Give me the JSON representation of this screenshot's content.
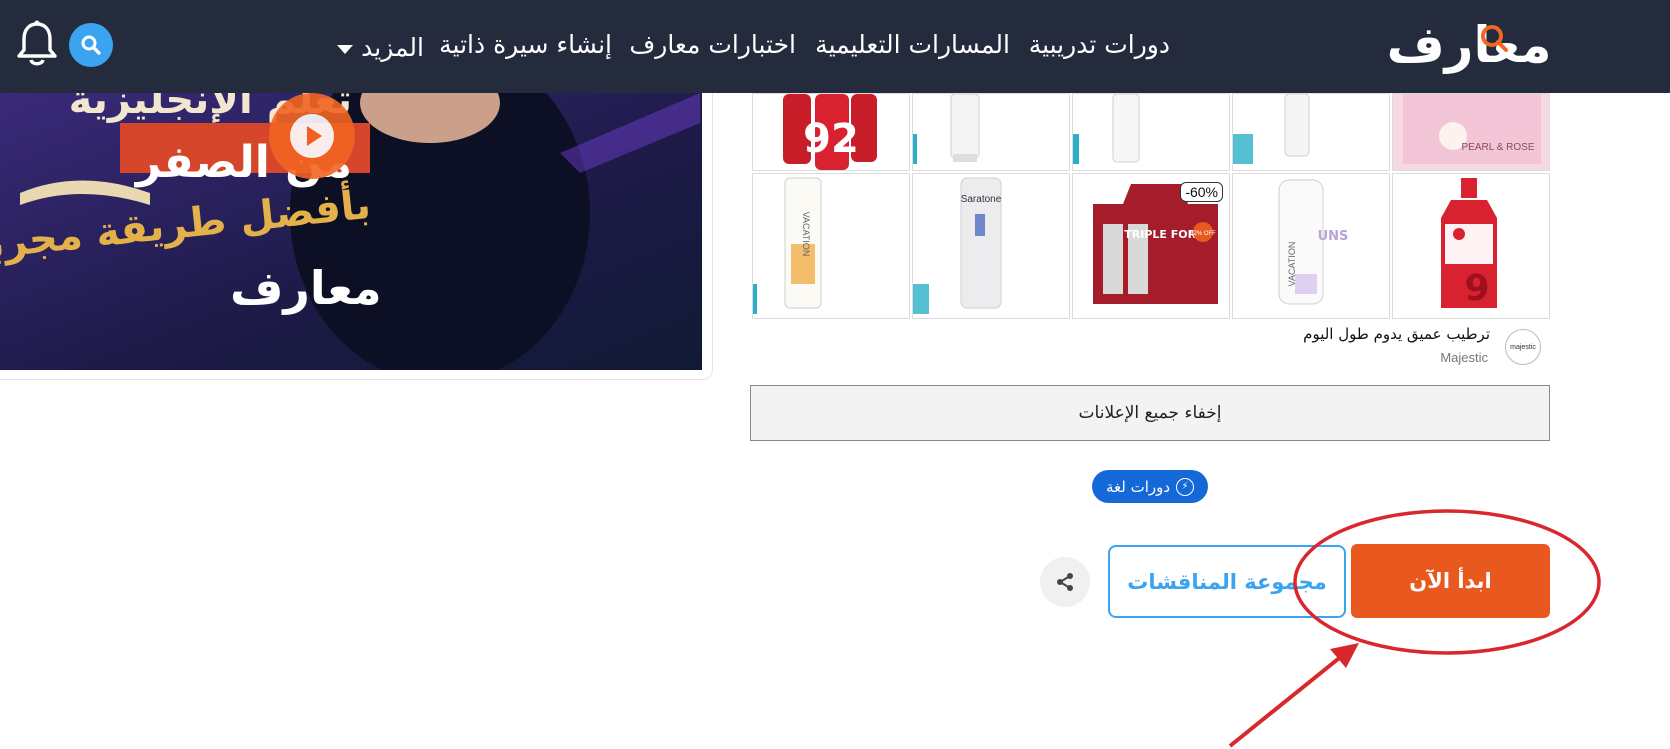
{
  "header": {
    "logo_text": "معارف",
    "nav": {
      "courses": "دورات تدريبية",
      "paths": "المسارات التعليمية",
      "tests": "اختبارات معارف",
      "cv": "إنشاء سيرة ذاتية",
      "more": "المزيد"
    },
    "icons": {
      "search": "search-icon",
      "notifications": "bell-icon"
    },
    "colors": {
      "bar": "#232b3d",
      "logo_accent": "#f26522",
      "search_bg": "#3aa4f0"
    }
  },
  "video": {
    "lines": [
      "تعلم الإنجليزية",
      "من الصفر",
      "بأفضل طريقة مجربة"
    ],
    "logo": "معارف",
    "play_icon": "play-icon"
  },
  "ads": {
    "discount_badge": "-60%",
    "product_texts": {
      "pearl": "PEARL & ROSE",
      "saratone": "Saratone",
      "triple": "TRIPLE FORCE",
      "triple_off": "52% OFF",
      "vacation": "VACATION",
      "uns": "UNS"
    },
    "caption": "ترطيب عميق يدوم طول اليوم",
    "sponsor": "Majestic",
    "sponsor_logo": "majestic"
  },
  "hide_ads_label": "إخفاء جميع الإعلانات",
  "category_badge": "دورات لغة",
  "actions": {
    "start": "ابدأ الآن",
    "discussions": "مجموعة المناقشات",
    "share_icon": "share-icon"
  },
  "annotation": {
    "color": "#d9272e"
  }
}
